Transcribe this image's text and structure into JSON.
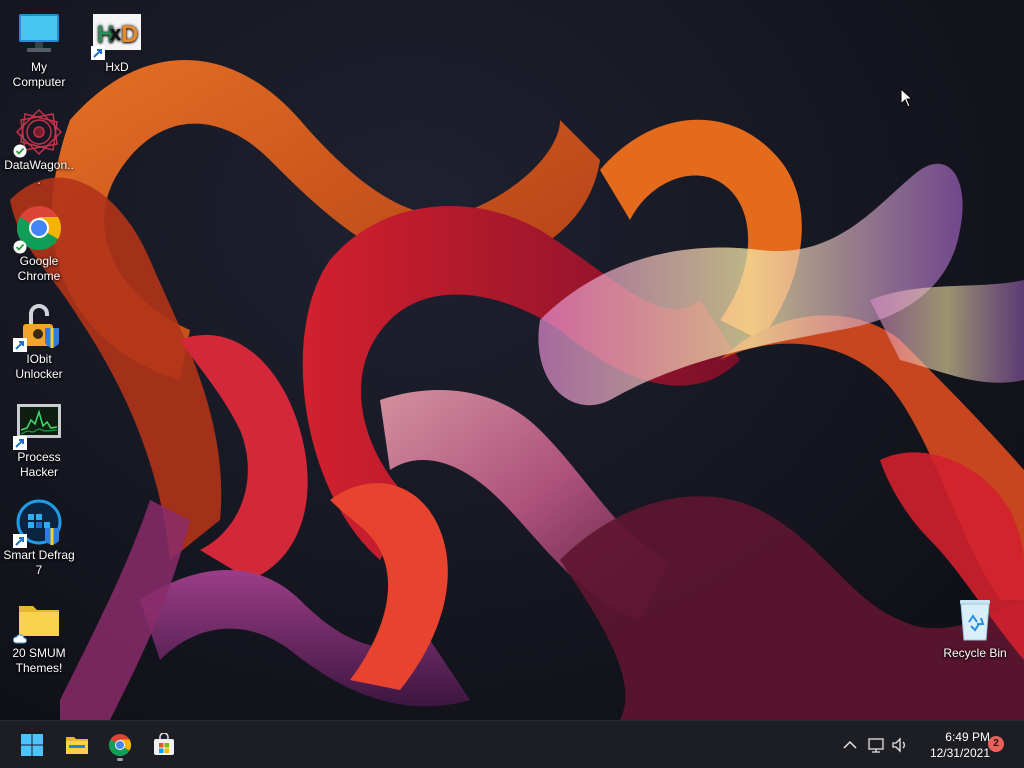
{
  "desktop_icons": [
    {
      "label": "My Computer",
      "icon": "monitor-icon",
      "shortcut": false
    },
    {
      "label": "HxD",
      "icon": "hxd-icon",
      "shortcut": true
    },
    {
      "label": "DataWagon...",
      "icon": "datawagon-icon",
      "shortcut": false,
      "status": "synced-check"
    },
    {
      "label": "Google Chrome",
      "icon": "chrome-icon",
      "shortcut": false,
      "status": "synced-check"
    },
    {
      "label": "IObit Unlocker",
      "icon": "iobit-unlocker-icon",
      "shortcut": true
    },
    {
      "label": "Process Hacker",
      "icon": "process-hacker-icon",
      "shortcut": true
    },
    {
      "label": "Smart Defrag 7",
      "icon": "smart-defrag-icon",
      "shortcut": true
    },
    {
      "label": "20 SMUM Themes!",
      "icon": "folder-icon",
      "shortcut": false,
      "status": "cloud"
    },
    {
      "label": "Recycle Bin",
      "icon": "recycle-bin-icon",
      "shortcut": false
    }
  ],
  "taskbar": {
    "pinned": [
      {
        "name": "Start",
        "icon": "windows-start-icon"
      },
      {
        "name": "File Explorer",
        "icon": "file-explorer-icon"
      },
      {
        "name": "Google Chrome",
        "icon": "chrome-icon"
      },
      {
        "name": "Microsoft Store",
        "icon": "store-icon"
      }
    ],
    "tray": {
      "overflow_icon": "chevron-up-icon",
      "network_icon": "network-icon",
      "volume_icon": "speaker-icon",
      "time": "6:49 PM",
      "date": "12/31/2021",
      "notification_count": "2"
    }
  },
  "colors": {
    "taskbar_bg": "#1d1e24",
    "accent_blue": "#4cc2ff",
    "notification_badge": "#e8625a",
    "ribbon_orange": "#e5621f",
    "ribbon_red": "#c21f2b"
  }
}
